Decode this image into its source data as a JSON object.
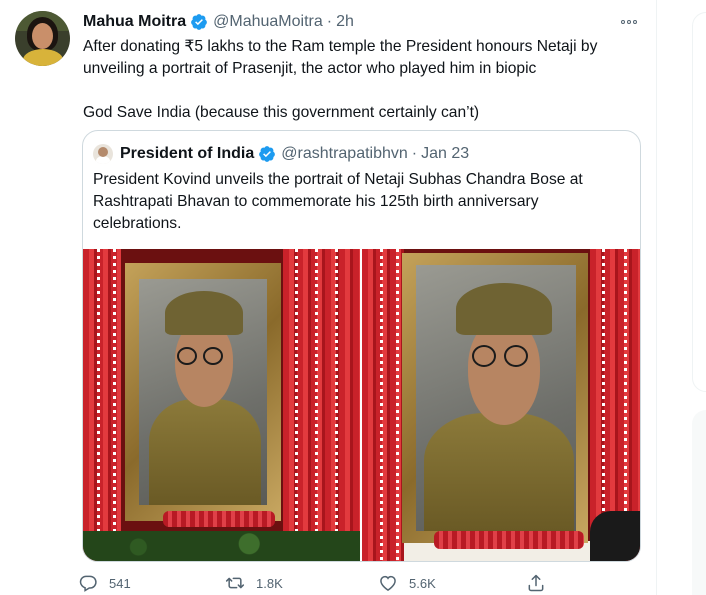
{
  "tweet": {
    "author_name": "Mahua Moitra",
    "handle": "@MahuaMoitra",
    "separator": "·",
    "time": "2h",
    "text_lines": [
      "After donating ₹5 lakhs to the Ram temple the President honours Netaji by",
      "unveiling a portrait of Prasenjit, the actor who played him in biopic"
    ],
    "text_line_3": "God Save India (because this government certainly can’t)",
    "icons": {
      "verified": "verified-badge-icon",
      "more": "more-options-icon"
    }
  },
  "quote": {
    "author_name": "President of India",
    "handle": "@rashtrapatibhvn",
    "separator": "·",
    "date": "Jan 23",
    "text_lines": [
      "President Kovind unveils the portrait of Netaji Subhas Chandra Bose at",
      "Rashtrapati Bhavan to commemorate his 125th birth anniversary",
      "celebrations."
    ]
  },
  "actions": {
    "reply": {
      "icon": "reply-icon",
      "count": "541"
    },
    "retweet": {
      "icon": "retweet-icon",
      "count": "1.8K"
    },
    "like": {
      "icon": "heart-icon",
      "count": "5.6K"
    },
    "share": {
      "icon": "share-icon"
    }
  },
  "colors": {
    "text": "#0f1419",
    "muted": "#536471",
    "verified": "#1d9bf0",
    "border": "#cfd9de"
  }
}
